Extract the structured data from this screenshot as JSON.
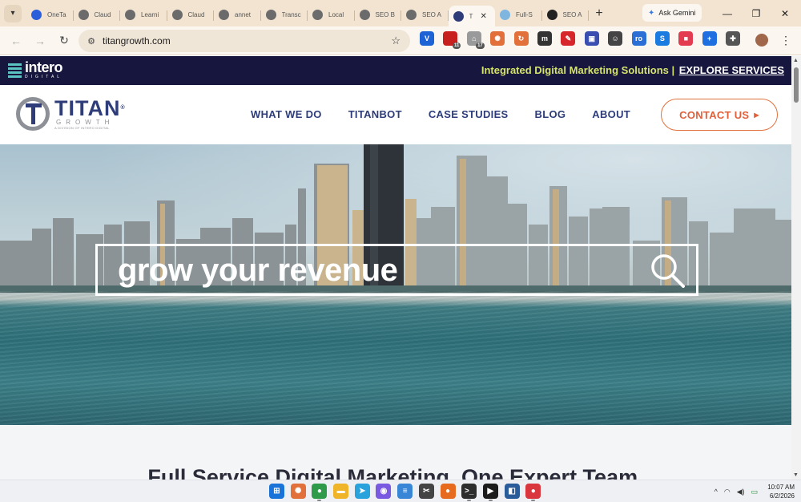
{
  "browser": {
    "tabs": [
      {
        "label": "OneTa",
        "icon": "onetab-icon",
        "color": "#2b5fd9"
      },
      {
        "label": "Claud",
        "icon": "globe-icon",
        "color": "#6b6b6b"
      },
      {
        "label": "Learni",
        "icon": "globe-icon",
        "color": "#6b6b6b"
      },
      {
        "label": "Claud",
        "icon": "globe-icon",
        "color": "#6b6b6b"
      },
      {
        "label": "annet",
        "icon": "globe-icon",
        "color": "#6b6b6b"
      },
      {
        "label": "Transc",
        "icon": "globe-icon",
        "color": "#6b6b6b"
      },
      {
        "label": "Local",
        "icon": "globe-icon",
        "color": "#6b6b6b"
      },
      {
        "label": "SEO B",
        "icon": "globe-icon",
        "color": "#6b6b6b"
      },
      {
        "label": "SEO A",
        "icon": "globe-icon",
        "color": "#6b6b6b"
      },
      {
        "label": "T",
        "icon": "titan-favicon-icon",
        "color": "#2e3d7a",
        "active": true
      },
      {
        "label": "Full-S",
        "icon": "page-icon",
        "color": "#7fb6e0"
      },
      {
        "label": "SEO A",
        "icon": "m-icon",
        "color": "#222222"
      }
    ],
    "new_tab": "+",
    "gemini_label": "Ask Gemini",
    "window_controls": {
      "minimize": "—",
      "restore": "❐",
      "close": "✕"
    },
    "url": "titangrowth.com",
    "extensions": [
      {
        "name": "vpn-extension-icon",
        "glyph": "V",
        "color": "#1e63d6"
      },
      {
        "name": "ublock-extension-icon",
        "glyph": "",
        "color": "#c8201f",
        "badge": "11"
      },
      {
        "name": "home-extension-icon",
        "glyph": "⌂",
        "color": "#9a9a9a",
        "badge": "17"
      },
      {
        "name": "claude-extension-icon",
        "glyph": "✺",
        "color": "#e2703a"
      },
      {
        "name": "refresh-extension-icon",
        "glyph": "↻",
        "color": "#e2703a"
      },
      {
        "name": "m-extension-icon",
        "glyph": "m",
        "color": "#333333"
      },
      {
        "name": "pdf-extension-icon",
        "glyph": "✎",
        "color": "#d6262b"
      },
      {
        "name": "screenshot-extension-icon",
        "glyph": "▣",
        "color": "#3a4db0"
      },
      {
        "name": "smiley-extension-icon",
        "glyph": "☺",
        "color": "#444444"
      },
      {
        "name": "ro-extension-icon",
        "glyph": "ro",
        "color": "#2b6fd6"
      },
      {
        "name": "blue-circle-extension-icon",
        "glyph": "S",
        "color": "#1a7be0"
      },
      {
        "name": "red-extension-icon",
        "glyph": "■",
        "color": "#e33b4f"
      },
      {
        "name": "plus-extension-icon",
        "glyph": "+",
        "color": "#1f6fe0"
      },
      {
        "name": "puzzle-extension-icon",
        "glyph": "✚",
        "color": "#555555"
      }
    ]
  },
  "site": {
    "intero_name": "intero",
    "intero_sub": "DIGITAL",
    "banner_text": "Integrated Digital Marketing Solutions |",
    "banner_link": "EXPLORE SERVICES",
    "logo_name": "TITAN",
    "logo_reg": "®",
    "logo_sub": "GROWTH",
    "logo_tag": "A DIVISION OF INTERO DIGITAL",
    "nav": [
      "WHAT WE DO",
      "TITANBOT",
      "CASE STUDIES",
      "BLOG",
      "ABOUT"
    ],
    "contact_label": "CONTACT US",
    "hero_search_text": "grow your revenue",
    "section_title": "Full Service Digital Marketing. One Expert Team."
  },
  "taskbar": {
    "apps": [
      {
        "name": "windows-start-icon",
        "glyph": "⊞",
        "color": "#1a73d9"
      },
      {
        "name": "claude-app-icon",
        "glyph": "✺",
        "color": "#e2703a"
      },
      {
        "name": "chrome-app-icon",
        "glyph": "●",
        "color": "#2e9a4a",
        "open": true
      },
      {
        "name": "file-explorer-icon",
        "glyph": "▬",
        "color": "#f0b429"
      },
      {
        "name": "telegram-icon",
        "glyph": "➤",
        "color": "#2aa3dd"
      },
      {
        "name": "copilot-icon",
        "glyph": "◉",
        "color": "#7a5ae0"
      },
      {
        "name": "notepad-icon",
        "glyph": "≡",
        "color": "#3a86d6"
      },
      {
        "name": "snipping-tool-icon",
        "glyph": "✂",
        "color": "#444444"
      },
      {
        "name": "firefox-icon",
        "glyph": "●",
        "color": "#e66b1f"
      },
      {
        "name": "terminal-icon",
        "glyph": ">_",
        "color": "#2d2d2d",
        "open": true
      },
      {
        "name": "media-player-icon",
        "glyph": "▶",
        "color": "#1c1c1c",
        "open": true
      },
      {
        "name": "vscode-icon",
        "glyph": "◧",
        "color": "#2a5c9a"
      },
      {
        "name": "chrome-alt-app-icon",
        "glyph": "●",
        "color": "#d9363e",
        "open": true
      }
    ],
    "tray_chevron": "^",
    "time": "10:07 AM",
    "date": "6/2/2026"
  }
}
